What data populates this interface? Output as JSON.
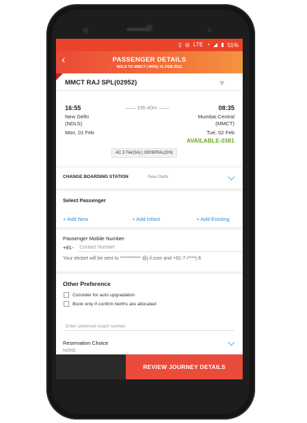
{
  "status_bar": {
    "lte_label": "LTE",
    "battery_label": "51%",
    "icons": [
      "vibrate-icon",
      "hotspot-icon",
      "lte-signal-icon",
      "wifi-icon",
      "signal-icon",
      "battery-icon"
    ]
  },
  "header": {
    "title": "PASSENGER DETAILS",
    "subtitle": "NDLS TO MMCT | MON, 01 FEB 2021",
    "back_icon": "back-arrow-icon"
  },
  "train": {
    "name": "MMCT RAJ SPL(02952)",
    "departure_time": "16:55",
    "arrival_time": "08:35",
    "duration": "—— 15h:40m ——",
    "from_station": "New Delhi",
    "from_code": "(NDLS)",
    "from_date": "Mon, 01 Feb",
    "to_station": "Mumbai Central",
    "to_code": "(MMCT)",
    "to_date": "Tue, 02 Feb",
    "availability": "AVAILABLE-0381",
    "class_quota": "AC 3 Tier(3A) | GENERAL(GN)",
    "fav_icon": "heart-icon"
  },
  "boarding": {
    "label": "CHANGE BOARDING STATION",
    "value": "New Delhi"
  },
  "passenger": {
    "title": "Select Passenger",
    "add_new": "+ Add New",
    "add_infant": "+ Add Infant",
    "add_existing": "+ Add Existing"
  },
  "mobile": {
    "label": "Passenger Mobile Number",
    "prefix": "+91-",
    "placeholder": "Contact Number",
    "note": "Your eticket will be sent to ***********     @j     il.com and +91-7    i****(   6"
  },
  "preferences": {
    "title": "Other Preference",
    "auto_upgrade": "Consider for auto upgradation",
    "confirm_berths": "Book only if confirm berths are allocated",
    "coach_placeholder": "Enter preferred coach number",
    "reservation_label": "Reservation Choice",
    "reservation_value": "NONE"
  },
  "footer": {
    "review_button": "REVIEW JOURNEY DETAILS"
  },
  "colors": {
    "brand": "#ea4b3a",
    "header_gradient_end": "#f4943f",
    "available": "#6ba628",
    "link": "#2a8fd1"
  }
}
